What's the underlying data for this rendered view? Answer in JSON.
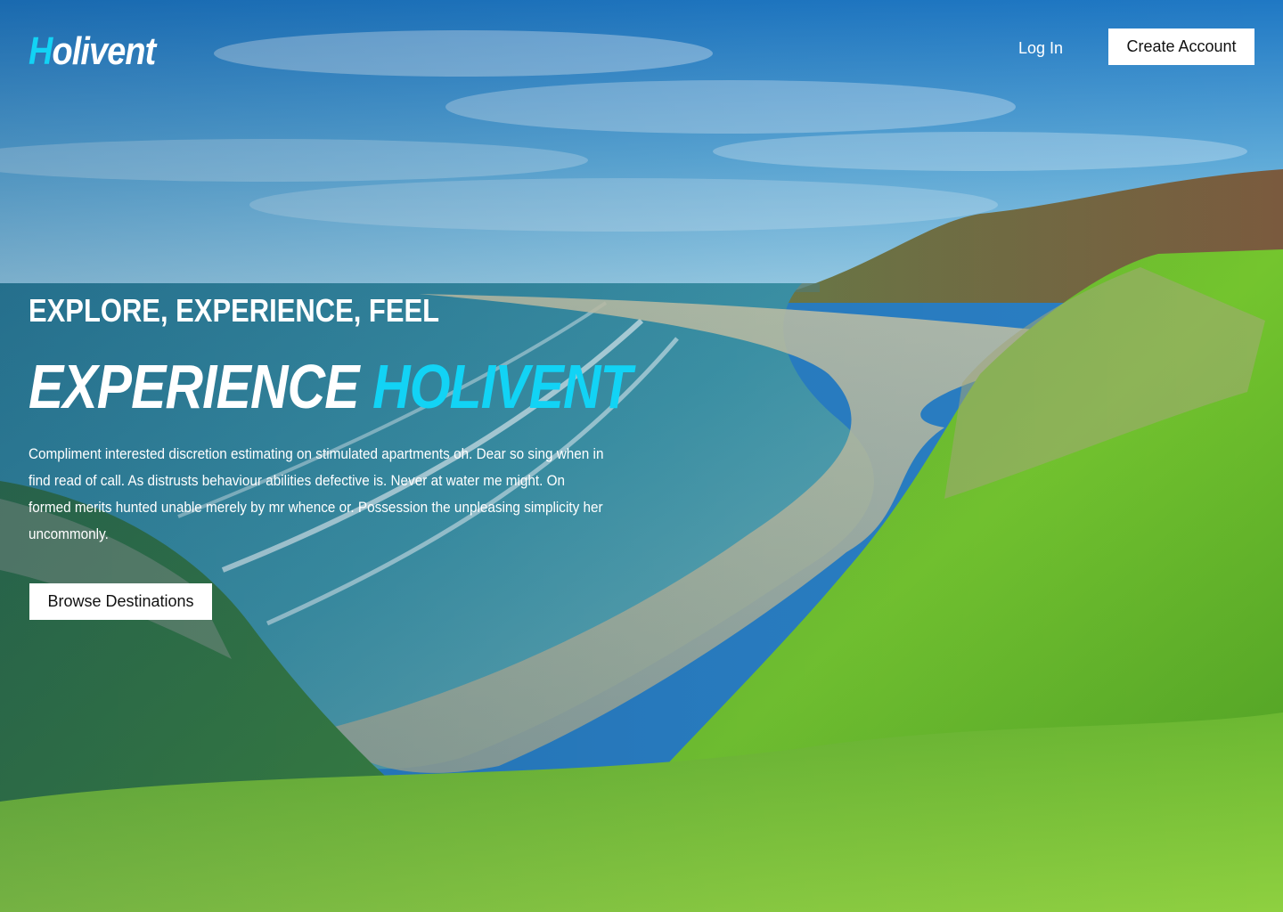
{
  "brand": {
    "logo_initial": "H",
    "logo_rest": "olivent",
    "accent_color": "#12d3f5"
  },
  "nav": {
    "login_label": "Log In",
    "create_account_label": "Create Account"
  },
  "hero": {
    "eyebrow": "EXPLORE, EXPERIENCE, FEEL",
    "headline_main": "EXPERIENCE",
    "headline_accent": "HOLIVENT",
    "body_lines": [
      "Compliment interested discretion estimating on stimulated apartments oh. Dear so sing when in",
      "find read of call. As distrusts behaviour abilities defective is. Never at water me might. On",
      "formed merits hunted unable merely by mr whence or. Possession the unpleasing simplicity her",
      "uncommonly."
    ],
    "cta_label": "Browse Destinations"
  },
  "background": {
    "description_icon": "coastal-landscape-photo"
  }
}
